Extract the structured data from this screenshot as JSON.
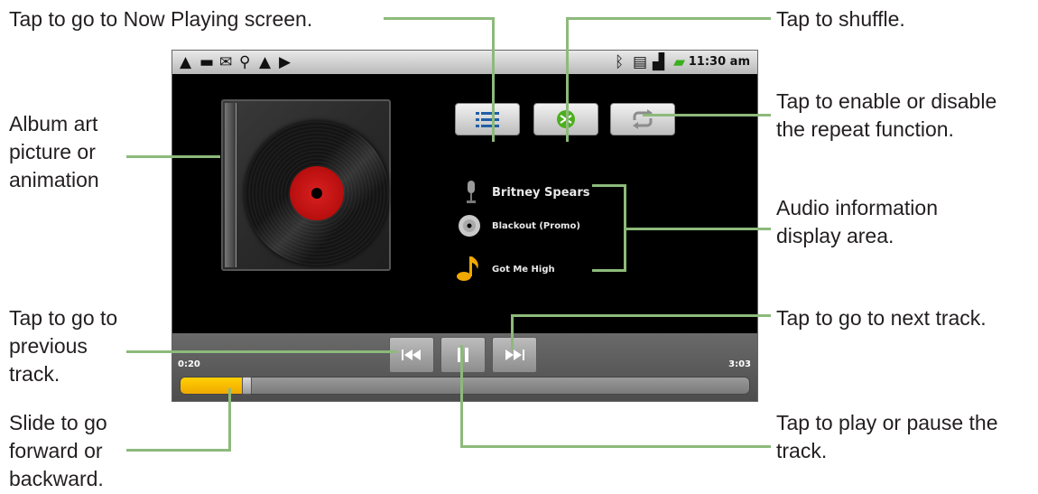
{
  "callouts": {
    "now_playing": "Tap to go to Now Playing screen.",
    "shuffle": "Tap to shuffle.",
    "repeat_1": "Tap to enable or disable",
    "repeat_2": "the repeat function.",
    "album_1": "Album art",
    "album_2": "picture or",
    "album_3": "animation",
    "audio_1": "Audio information",
    "audio_2": "display area.",
    "prev_1": "Tap to go to",
    "prev_2": "previous",
    "prev_3": "track.",
    "next": "Tap to go to next track.",
    "slide_1": "Slide to go",
    "slide_2": "forward or",
    "slide_3": "backward.",
    "play_1": "Tap to play or pause the",
    "play_2": "track."
  },
  "statusbar": {
    "left_icons": [
      "warning-icon",
      "chat-icon",
      "mail-icon",
      "usb-icon",
      "warning-icon",
      "play-icon"
    ],
    "right_icons": [
      "bluetooth-icon",
      "vibrate-icon",
      "signal-icon",
      "battery-icon"
    ],
    "time": "11:30 am"
  },
  "track_info": {
    "artist": "Britney Spears",
    "album": "Blackout (Promo)",
    "song": "Got Me High"
  },
  "playback": {
    "elapsed": "0:20",
    "duration": "3:03",
    "progress_fraction": 0.11
  },
  "colors": {
    "callout_line": "#8dba7b",
    "seek_fill": "#f5b800",
    "record_label": "#c8141a",
    "screen_bg": "#000000"
  }
}
